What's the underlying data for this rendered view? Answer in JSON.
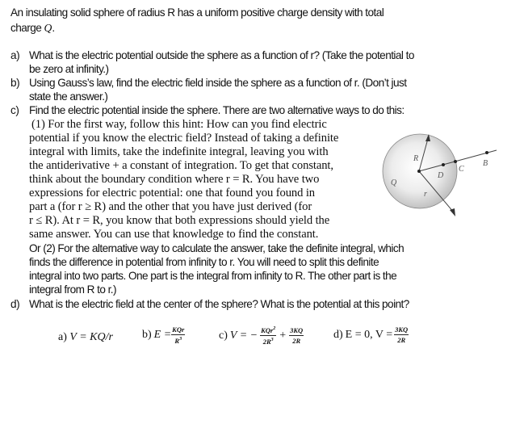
{
  "problem": {
    "intro_line1": "An insulating solid sphere of radius R has a uniform positive charge density with total",
    "intro_line2_prefix": "charge ",
    "intro_line2_var": "Q",
    "intro_line2_suffix": "."
  },
  "parts": {
    "a": {
      "label": "a)",
      "line1": "What is the electric potential outside the sphere as a function of r? (Take the potential to",
      "line2": "be zero at infinity.)"
    },
    "b": {
      "label": "b)",
      "line1": "Using Gauss’s law, find the electric field inside the sphere as a function of r. (Don’t just",
      "line2": "state the answer.)"
    },
    "c": {
      "label": "c)",
      "line1": "Find the electric potential inside the sphere. There are two alternative ways to do this:",
      "hint_lines": [
        "(1) For the first way, follow this hint: How can you find electric",
        "potential if you know the electric field? Instead of taking a definite",
        "integral with limits, take the indefinite integral, leaving you with",
        "the antiderivative + a constant of integration. To get that constant,",
        "think about the boundary condition where r = R. You have two",
        "expressions for electric potential: one that found you found in",
        "part a (for r ≥ R) and the other that you have just derived (for",
        "r ≤ R). At r = R, you know that both expressions should yield the",
        "same answer. You can use that knowledge to find the constant."
      ],
      "alt_lines": [
        "Or (2) For the alternative way to calculate the answer, take the definite integral, which",
        "finds the difference in potential from infinity to r. You will need to split this definite",
        "integral into two parts. One part is the integral from infinity to R. The other part is the",
        "integral from R to r.)"
      ]
    },
    "d": {
      "label": "d)",
      "line1": "What is the electric field at the center of the sphere? What is the potential at this point?"
    }
  },
  "figure": {
    "labels": {
      "R": "R",
      "Q": "Q",
      "D": "D",
      "C": "C",
      "B": "B",
      "r": "r"
    },
    "sphere_color": "#d8d8d8",
    "line_color": "#444444"
  },
  "answers": {
    "a": {
      "label": "a) ",
      "expr": "V = KQ/r"
    },
    "b": {
      "label": "b) ",
      "lhs": "E = ",
      "num": "KQr",
      "den": "R3"
    },
    "c": {
      "label": "c) ",
      "lhs": "V = −",
      "num1": "KQr2",
      "den1": "2R3",
      "plus": "+",
      "num2": "3KQ",
      "den2": "2R"
    },
    "d": {
      "label": "d) ",
      "lhs": "E = 0, V = ",
      "num": "3KQ",
      "den": "2R"
    }
  }
}
